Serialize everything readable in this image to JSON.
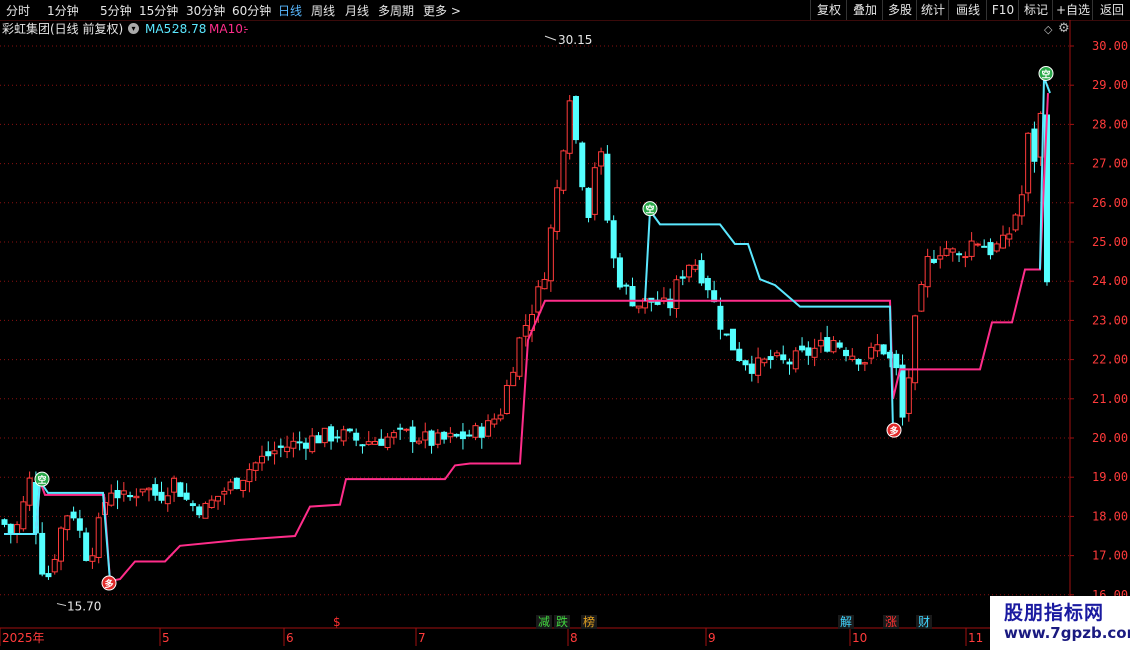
{
  "toolbar": {
    "tabs": [
      {
        "label": "分时",
        "active": false
      },
      {
        "label": "1分钟",
        "active": false
      },
      {
        "label": "5分钟",
        "active": false
      },
      {
        "label": "15分钟",
        "active": false
      },
      {
        "label": "30分钟",
        "active": false
      },
      {
        "label": "60分钟",
        "active": false
      },
      {
        "label": "日线",
        "active": true
      },
      {
        "label": "周线",
        "active": false
      },
      {
        "label": "月线",
        "active": false
      },
      {
        "label": "多周期",
        "active": false
      },
      {
        "label": "更多",
        "active": false
      }
    ],
    "right_buttons": [
      "复权",
      "叠加",
      "多股",
      "统计",
      "画线",
      "F10",
      "标记",
      "+自选",
      "返回"
    ]
  },
  "legend": {
    "title": "彩虹集团(日线 前复权)",
    "ma5_label": "MA5:",
    "ma5_value": "28.78",
    "ma10_label": "MA10:",
    "ma10_value": "-"
  },
  "y_axis_labels": [
    "30.00",
    "29.00",
    "28.00",
    "27.00",
    "26.00",
    "25.00",
    "24.00",
    "23.00",
    "22.00",
    "21.00",
    "20.00",
    "19.00",
    "18.00",
    "17.00",
    "16.00"
  ],
  "x_axis_labels": [
    "2025年",
    "5",
    "6",
    "7",
    "8",
    "9",
    "10",
    "11"
  ],
  "price_annotations": {
    "high": "30.15",
    "low": "15.70"
  },
  "signals": {
    "buy": "多",
    "sell": "空"
  },
  "event_markers": [
    {
      "label": "$",
      "color": "#ff3030"
    },
    {
      "label": "减",
      "color": "#3fd63f"
    },
    {
      "label": "跌",
      "color": "#3fd63f"
    },
    {
      "label": "榜",
      "color": "#e0a020"
    },
    {
      "label": "解",
      "color": "#3fd6ff"
    },
    {
      "label": "涨",
      "color": "#ff3030"
    },
    {
      "label": "财",
      "color": "#3fd6ff"
    }
  ],
  "colors": {
    "up": "#ff3b3b",
    "down": "#54ffff",
    "line_up": "#ff2d8a",
    "line_down": "#5be8ff",
    "grid": "#8a1010",
    "axis_text": "#ff3b3b"
  },
  "chart_data": {
    "type": "candlestick",
    "ylim": [
      16.0,
      30.0
    ],
    "x_ticks": [
      "2025年",
      "5",
      "6",
      "7",
      "8",
      "9",
      "10",
      "11"
    ],
    "highest": 30.15,
    "lowest": 15.7,
    "key_points": [
      {
        "date_region": "4月初",
        "price": 18.9,
        "signal": "空"
      },
      {
        "date_region": "4月",
        "price": 16.3,
        "signal": "多"
      },
      {
        "date_region": "8月",
        "price": 30.15,
        "note": "最高"
      },
      {
        "date_region": "8月",
        "price": 25.8,
        "signal": "空"
      },
      {
        "date_region": "10月",
        "price": 20.2,
        "signal": "多"
      },
      {
        "date_region": "11月",
        "price": 29.2,
        "signal": "空"
      }
    ],
    "trend_lines": [
      {
        "name": "支撑线",
        "color": "#ff2d8a"
      },
      {
        "name": "压力线",
        "color": "#5be8ff"
      }
    ]
  },
  "watermark": {
    "title": "股朋指标网",
    "url": "www.7gpzb.com"
  }
}
